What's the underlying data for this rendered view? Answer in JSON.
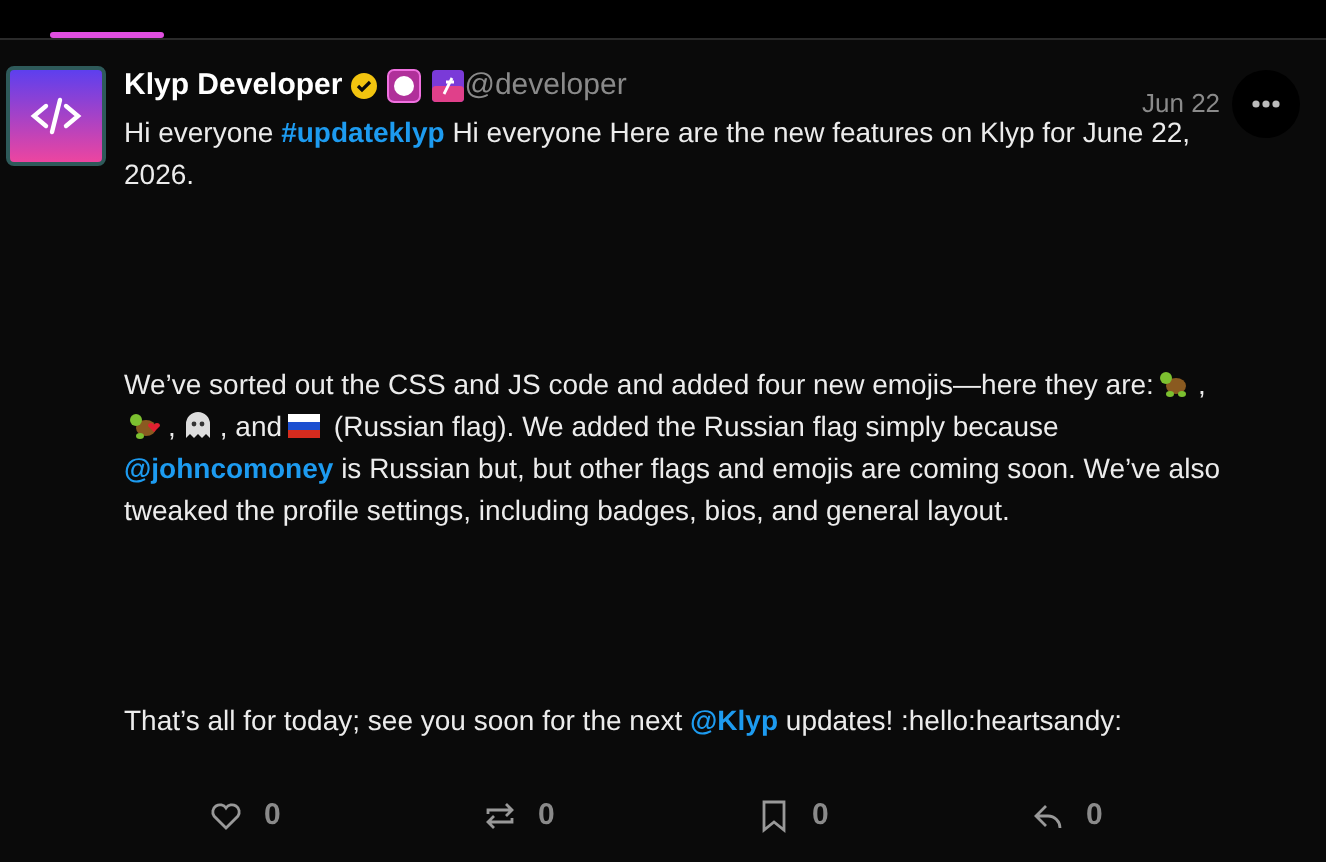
{
  "post": {
    "author": "Klyp Developer",
    "handle": "@developer",
    "date": "Jun 22",
    "paragraphs": [
      [
        {
          "kind": "text",
          "text": "Hi everyone"
        },
        {
          "kind": "hashtag",
          "text": "#updateklyp"
        },
        {
          "kind": "text",
          "text": "Hi everyone Here are the new features on Klyp for June 22, 2026."
        }
      ],
      [
        {
          "kind": "text",
          "text": "We’ve sorted out the CSS and JS code and added four new emojis—here they are:"
        },
        {
          "kind": "emoji"
        },
        {
          "kind": "text",
          "text": ","
        },
        {
          "kind": "emoji"
        },
        {
          "kind": "text",
          "text": ","
        },
        {
          "kind": "emoji"
        },
        {
          "kind": "text",
          "text": ", and"
        },
        {
          "kind": "emoji"
        },
        {
          "kind": "text",
          "text": "(Russian flag). We added the Russian flag simply because"
        },
        {
          "kind": "mention",
          "text": "@johncomoney"
        },
        {
          "kind": "text",
          "text": "is Russian but, but other flags and emojis are coming soon. We’ve also tweaked the profile settings, including badges, bios, and general layout."
        }
      ],
      [
        {
          "kind": "text",
          "text": "That’s all for today; see you soon for the next"
        },
        {
          "kind": "mention",
          "text": "@Klyp"
        },
        {
          "kind": "text",
          "text": "updates! :hello:heartsandy:"
        }
      ]
    ],
    "actions": [
      {
        "kind": "like",
        "count": "0"
      },
      {
        "kind": "repost",
        "count": "0"
      },
      {
        "kind": "bookmark",
        "count": "0"
      },
      {
        "kind": "reply",
        "count": "0"
      }
    ]
  }
}
